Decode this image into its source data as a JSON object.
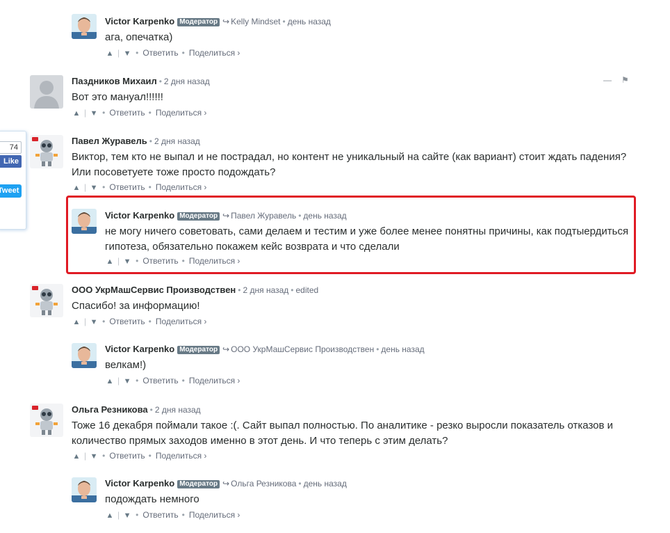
{
  "share": {
    "count": "74",
    "like": "Like",
    "tweet": "Tweet"
  },
  "labels": {
    "moderator_badge": "Модератор",
    "reply": "Ответить",
    "share": "Поделиться ›",
    "up": "▲",
    "down": "▼",
    "separator": "|",
    "bullet": "•",
    "reply_arrow": "↪",
    "collapse": "—",
    "flag": "⚑"
  },
  "colors": {
    "highlight_border": "#e01b24",
    "moderator_badge": "#687a86",
    "facebook": "#4267b2",
    "twitter": "#1da1f2"
  },
  "comments": [
    {
      "author": "Victor Karpenko",
      "moderator": true,
      "reply_to": "Kelly Mindset",
      "time": "день назад",
      "text": "ага, опечатка)",
      "avatar": "man-photo"
    },
    {
      "author": "Паздников Михаил",
      "moderator": false,
      "time": "2 дня назад",
      "text": "Вот это мануал!!!!!!",
      "avatar": "default-avatar"
    },
    {
      "author": "Павел Журавель",
      "moderator": false,
      "time": "2 дня назад",
      "text_lines": [
        "Виктор, тем кто не выпал и не пострадал, но контент не уникальный на сайте (как вариант) стоит ждать падения?",
        "Или посоветуете тоже просто подождать?"
      ],
      "avatar": "robot-avatar"
    },
    {
      "author": "Victor Karpenko",
      "moderator": true,
      "reply_to": "Павел Журавель",
      "time": "день назад",
      "text_lines": [
        "не могу ничего советовать, сами делаем и тестим и уже более менее понятны причины, как подтыердиться",
        "гипотеза, обязательно покажем кейс возврата и что сделали"
      ],
      "avatar": "man-photo",
      "highlighted": true
    },
    {
      "author": "ООО УкрМашСервис Производствен",
      "moderator": false,
      "time": "2 дня назад",
      "edited": "edited",
      "text": "Спасибо! за информацию!",
      "avatar": "robot-avatar"
    },
    {
      "author": "Victor Karpenko",
      "moderator": true,
      "reply_to": "ООО УкрМашСервис Производствен",
      "time": "день назад",
      "text": "велкам!)",
      "avatar": "man-photo"
    },
    {
      "author": "Ольга Резникова",
      "moderator": false,
      "time": "2 дня назад",
      "text_lines": [
        "Тоже 16 декабря поймали такое :(. Сайт выпал полностью. По аналитике - резко выросли показатель отказов и",
        "количество прямых заходов именно в этот день. И что теперь с этим делать?"
      ],
      "avatar": "robot-avatar"
    },
    {
      "author": "Victor Karpenko",
      "moderator": true,
      "reply_to": "Ольга Резникова",
      "time": "день назад",
      "text": "подождать немного",
      "avatar": "man-photo"
    }
  ]
}
